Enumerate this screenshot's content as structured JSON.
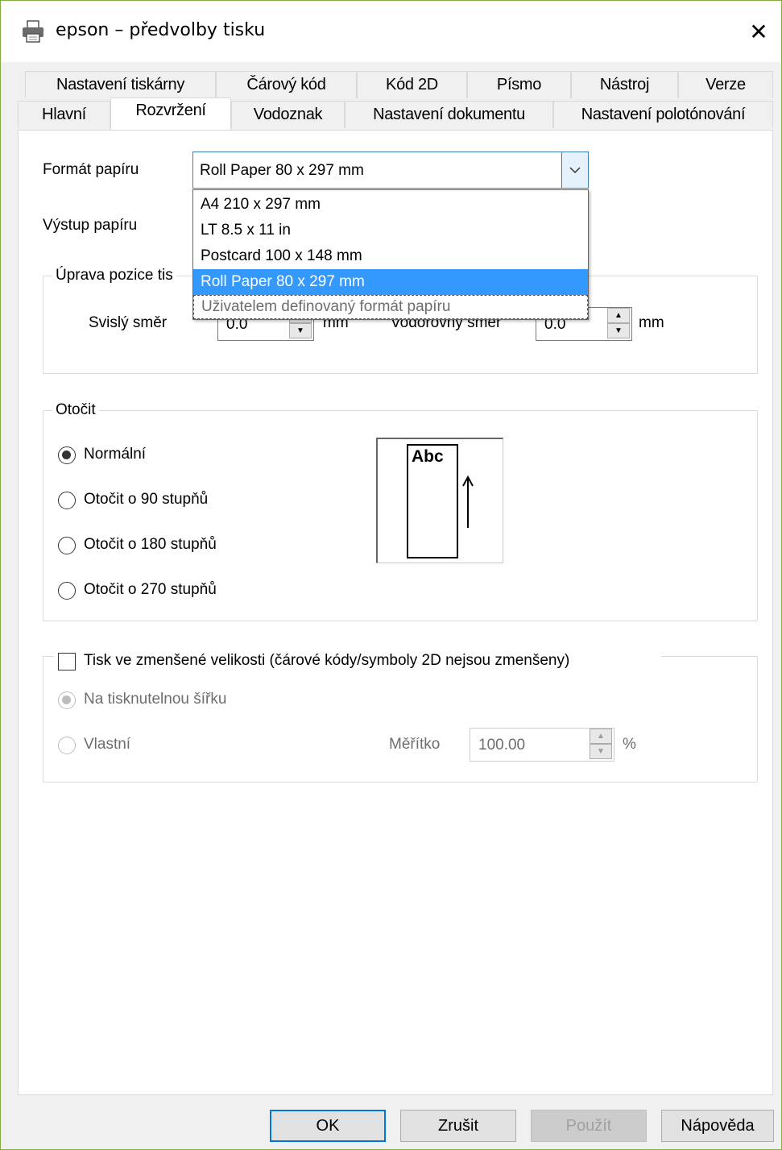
{
  "window": {
    "title": "epson – předvolby tisku",
    "close_glyph": "✕",
    "icon": "printer-icon"
  },
  "tabs_row1": [
    "Nastavení tiskárny",
    "Čárový kód",
    "Kód 2D",
    "Písmo",
    "Nástroj",
    "Verze"
  ],
  "tabs_row2": [
    "Hlavní",
    "Rozvržení",
    "Vodoznak",
    "Nastavení dokumentu",
    "Nastavení polotónování"
  ],
  "active_tab": "Rozvržení",
  "paper": {
    "format_label": "Formát papíru",
    "format_value": "Roll Paper 80 x 297 mm",
    "output_label": "Výstup papíru",
    "options": [
      "A4 210 x 297 mm",
      "LT 8.5 x 11 in",
      "Postcard 100 x 148 mm",
      "Roll Paper 80 x 297 mm",
      "Uživatelem definovaný formát papíru"
    ],
    "selected_option": "Roll Paper 80 x 297 mm"
  },
  "position": {
    "legend": "Úprava pozice tis",
    "vertical_label": "Svislý směr",
    "vertical_value": "0.0",
    "vertical_unit": "mm",
    "horizontal_label": "Vodorovný směr",
    "horizontal_value": "0.0",
    "horizontal_unit": "mm"
  },
  "rotate": {
    "legend": "Otočit",
    "options": [
      "Normální",
      "Otočit o 90 stupňů",
      "Otočit o 180 stupňů",
      "Otočit o 270 stupňů"
    ],
    "selected": "Normální",
    "preview_text": "Abc"
  },
  "reduced": {
    "checkbox_label": "Tisk ve zmenšené velikosti (čárové kódy/symboly 2D nejsou zmenšeny)",
    "checked": false,
    "option_fit": "Na tisknutelnou šířku",
    "option_custom": "Vlastní",
    "scale_label": "Měřítko",
    "scale_value": "100.00",
    "scale_unit": "%"
  },
  "buttons": {
    "ok": "OK",
    "cancel": "Zrušit",
    "apply": "Použít",
    "help": "Nápověda"
  },
  "colors": {
    "accent": "#0078d7",
    "selection": "#3399ff",
    "window_border": "#7fae3f"
  }
}
